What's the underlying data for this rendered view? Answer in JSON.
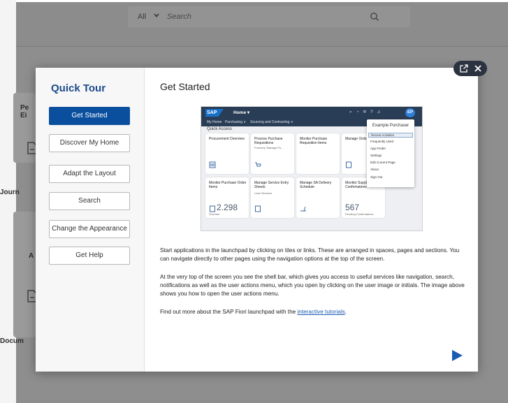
{
  "background": {
    "search": {
      "scope": "All",
      "placeholder": "Search"
    },
    "labels": [
      "Pe",
      "Ei",
      "Journ",
      "A",
      "Docum"
    ]
  },
  "dialog": {
    "title": "Quick Tour",
    "nav": [
      {
        "label": "Get Started",
        "active": true
      },
      {
        "label": "Discover My Home",
        "active": false
      },
      {
        "label": "Adapt the Layout",
        "active": false
      },
      {
        "label": "Search",
        "active": false
      },
      {
        "label": "Change the Appearance",
        "active": false
      },
      {
        "label": "Get Help",
        "active": false
      }
    ],
    "content": {
      "heading": "Get Started",
      "paragraph1": "Start applications in the launchpad by clicking on tiles or links. These are arranged in spaces, pages and sections. You can navigate directly to other pages using the navigation options at the top of the screen.",
      "paragraph2": "At the very top of the screen you see the shell bar, which gives you access to useful services like navigation, search, notifications as well as the user actions menu, which you open by clicking on the user image or initials. The image above shows you how to open the user actions menu.",
      "paragraph3_prefix": "Find out more about the SAP Fiori launchpad with the ",
      "paragraph3_link": "interactive tutorials",
      "paragraph3_suffix": "."
    }
  },
  "screenshot": {
    "logo": "SAP",
    "home": "Home ▾",
    "nav": [
      "My Home",
      "Purchasing ∨",
      "Sourcing and Contracting ∨"
    ],
    "section": "Quick Access",
    "avatar": "EP",
    "tiles": [
      {
        "title": "Procurement Overview",
        "sub": "",
        "num": "",
        "foot": ""
      },
      {
        "title": "Process Purchase Requisitions",
        "sub": "Formerly 'Manage Pu...",
        "num": "",
        "foot": ""
      },
      {
        "title": "Monitor Purchase Requisition Items",
        "sub": "",
        "num": "",
        "foot": ""
      },
      {
        "title": "Manage Orders",
        "sub": "",
        "num": "",
        "foot": ""
      },
      {
        "title": "Monitor Purchase Order Items",
        "sub": "",
        "num": "2.298",
        "foot": "Overdue"
      },
      {
        "title": "Manage Service Entry Sheets",
        "sub": "Lean Services",
        "num": "",
        "foot": ""
      },
      {
        "title": "Manage SA Delivery Schedule",
        "sub": "",
        "num": "",
        "foot": ""
      },
      {
        "title": "Monitor Supplier Confirmations",
        "sub": "",
        "num": "567",
        "foot": "Pending Confirmations"
      }
    ],
    "menu": {
      "header": "Example Purchaser",
      "items": [
        "Recent Activities",
        "Frequently Used",
        "App Finder",
        "Settings",
        "Edit Current Page",
        "About",
        "Sign Out"
      ]
    }
  },
  "colors": {
    "accent": "#0a4f9e",
    "title": "#1c4a8a",
    "next": "#1a5bb3"
  }
}
